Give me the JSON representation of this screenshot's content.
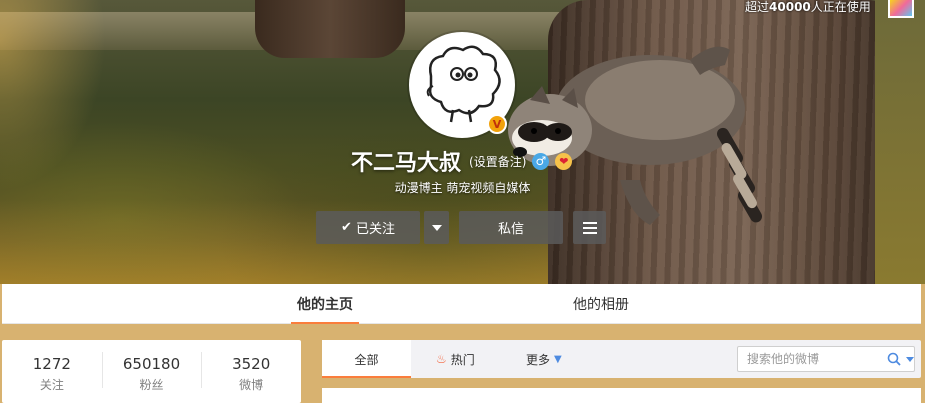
{
  "top_bar": {
    "usage_prefix": "超过",
    "usage_count": "40000",
    "usage_suffix": "人正在使用"
  },
  "profile": {
    "name": "不二马大叔",
    "remark_link": "(设置备注)",
    "verified_badge": "V",
    "gender_symbol": "♂",
    "intro": "动漫博主 萌宠视频自媒体"
  },
  "actions": {
    "follow_label": "已关注",
    "message_label": "私信"
  },
  "tabs": [
    {
      "label": "他的主页"
    },
    {
      "label": "他的相册"
    }
  ],
  "stats": [
    {
      "value": "1272",
      "label": "关注"
    },
    {
      "value": "650180",
      "label": "粉丝"
    },
    {
      "value": "3520",
      "label": "微博"
    }
  ],
  "feed": {
    "tab_all": "全部",
    "tab_hot": "热门",
    "tab_more": "更多",
    "search_placeholder": "搜索他的微博"
  },
  "colors": {
    "accent": "#fa7d3c",
    "link_blue": "#4e8be0",
    "verified_gold": "#f2a20b"
  }
}
